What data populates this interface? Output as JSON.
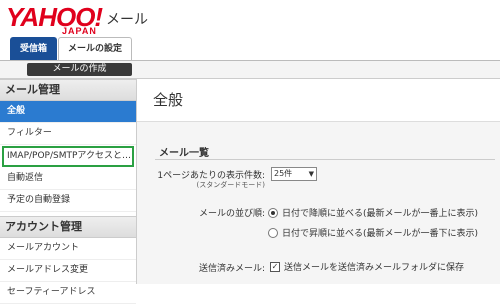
{
  "header": {
    "logo_text": "YAHOO!",
    "logo_sub": "JAPAN",
    "product_name": "メール"
  },
  "tabs": [
    {
      "label": "受信箱",
      "active": true
    },
    {
      "label": "メールの設定",
      "active": false
    }
  ],
  "compose": {
    "label": "メールの作成"
  },
  "sidebar": {
    "mail_management": {
      "header": "メール管理",
      "items": [
        {
          "label": "全般",
          "active": true
        },
        {
          "label": "フィルター"
        },
        {
          "label": "IMAP/POP/SMTPアクセスと…",
          "highlighted": true
        },
        {
          "label": "自動返信"
        },
        {
          "label": "予定の自動登録"
        }
      ]
    },
    "account_management": {
      "header": "アカウント管理",
      "items": [
        {
          "label": "メールアカウント"
        },
        {
          "label": "メールアドレス変更"
        },
        {
          "label": "セーフティーアドレス"
        }
      ]
    }
  },
  "main": {
    "title": "全般",
    "section_title": "メール一覧",
    "per_page": {
      "label": "1ページあたりの表示件数:",
      "sublabel": "(スタンダードモード)",
      "selected": "25件"
    },
    "sort": {
      "label": "メールの並び順:",
      "options": [
        {
          "label": "日付で降順に並べる(最新メールが一番上に表示)",
          "checked": true
        },
        {
          "label": "日付で昇順に並べる(最新メールが一番下に表示)",
          "checked": false
        }
      ]
    },
    "sent_mail": {
      "label": "送信済みメール:",
      "checkbox_label": "送信メールを送信済みメールフォルダに保存",
      "checked": true
    }
  }
}
